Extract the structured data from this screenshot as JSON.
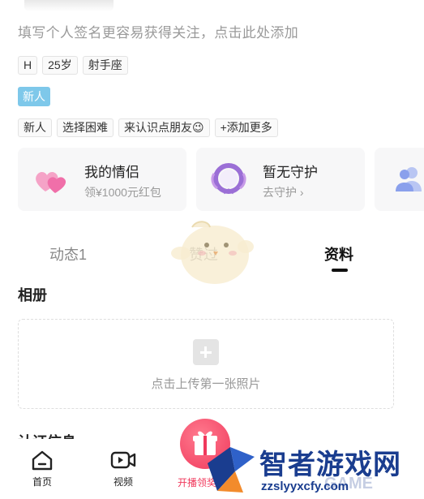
{
  "profile": {
    "signature_hint": "填写个人签名更容易获得关注，点击此处添加",
    "basic_tags": [
      "H",
      "25岁",
      "射手座"
    ],
    "new_badge": "新人",
    "interest_tags": [
      "新人",
      "选择困难",
      "来认识点朋友😉"
    ],
    "add_more": "+添加更多"
  },
  "cards": {
    "couple": {
      "title": "我的情侣",
      "sub": "领¥1000元红包"
    },
    "guard": {
      "title": "暂无守护",
      "sub": "去守护 ›"
    }
  },
  "tabs": {
    "dynamic": "动态1",
    "gift": "赞过",
    "info": "资料"
  },
  "album": {
    "title": "相册",
    "upload_label": "点击上传第一张照片"
  },
  "certification": {
    "title": "认证信息"
  },
  "bottom_nav": {
    "home": "首页",
    "video": "视频",
    "live": "开播领奖"
  },
  "watermark": {
    "title": "智者游戏网",
    "url": "zzslyyxcfy.com",
    "faded": "GAME"
  },
  "colors": {
    "accent": "#f0395c",
    "new_badge": "#7ec8ea",
    "watermark": "#1a3d8f"
  }
}
